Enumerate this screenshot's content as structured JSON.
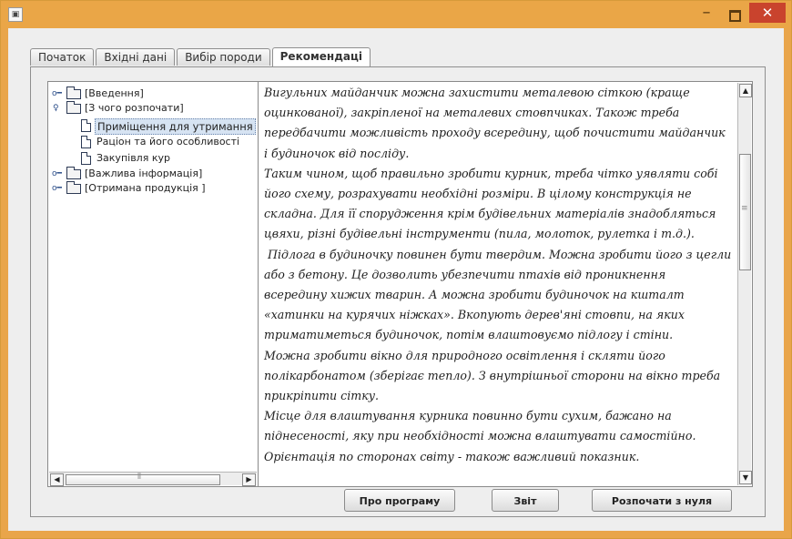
{
  "window": {
    "app_icon": "app-window-icon",
    "controls": {
      "minimize": "–",
      "close": "✕"
    }
  },
  "tabs": [
    {
      "label": "Початок",
      "active": false
    },
    {
      "label": "Вхідні дані",
      "active": false
    },
    {
      "label": "Вибір породи",
      "active": false
    },
    {
      "label": "Рекомендаці",
      "active": true
    }
  ],
  "tree": {
    "nodes": [
      {
        "label": "[Введення]",
        "type": "folder",
        "expanded": false,
        "level": 0
      },
      {
        "label": "[З чого розпочати]",
        "type": "folder",
        "expanded": true,
        "level": 0
      },
      {
        "label": "Приміщення для утримання",
        "type": "document",
        "selected": true,
        "level": 1
      },
      {
        "label": "Раціон та його особливості",
        "type": "document",
        "selected": false,
        "level": 1
      },
      {
        "label": "Закупівля кур",
        "type": "document",
        "selected": false,
        "level": 1
      },
      {
        "label": "[Важлива інформація]",
        "type": "folder",
        "expanded": false,
        "level": 0
      },
      {
        "label": "[Отримана продукція ]",
        "type": "folder",
        "expanded": false,
        "level": 0
      }
    ],
    "hscroll": {
      "left_arrow": "◀",
      "right_arrow": "▶",
      "grip": "⦀"
    }
  },
  "content": {
    "paragraph": "Вигульних майданчик можна захистити металевою сіткою (краще оцинкованої), закріпленої на металевих стовпчиках. Також треба передбачити можливість проходу всередину, щоб почистити майданчик і будиночок від посліду.\nТаким чином, щоб правильно зробити курник, треба чітко уявляти собі його схему, розрахувати необхідні розміри. В цілому конструкція не складна. Для її спорудження крім будівельних матеріалів знадобляться цвяхи, різні будівельні інструменти (пила, молоток, рулетка і т.д.).\n Підлога в будиночку повинен бути твердим. Можна зробити його з цегли або з бетону. Це дозволить убезпечити птахів від проникнення всередину хижих тварин. А можна зробити будиночок на кшталт «хатинки на курячих ніжках». Вкопують дерев'яні стовпи, на яких триматиметься будиночок, потім влаштовуємо підлогу і стіни.\nМожна зробити вікно для природного освітлення і скляти його полікарбонатом (зберігає тепло). З внутрішньої сторони на вікно треба прикріпити сітку.\nМісце для влаштування курника повинно бути сухим, бажано на піднесеності, яку при необхідності можна влаштувати самостійно. Орієнтація по сторонах світу - також важливий показник.",
    "vscroll": {
      "up_arrow": "▲",
      "down_arrow": "▼",
      "grip": "≡"
    }
  },
  "buttons": {
    "about": "Про програму",
    "report": "Звіт",
    "restart": "Розпочати з нуля"
  },
  "colors": {
    "title_bar": "#eaa647",
    "close_button": "#c9432d",
    "selection": "#d6e3f2"
  }
}
